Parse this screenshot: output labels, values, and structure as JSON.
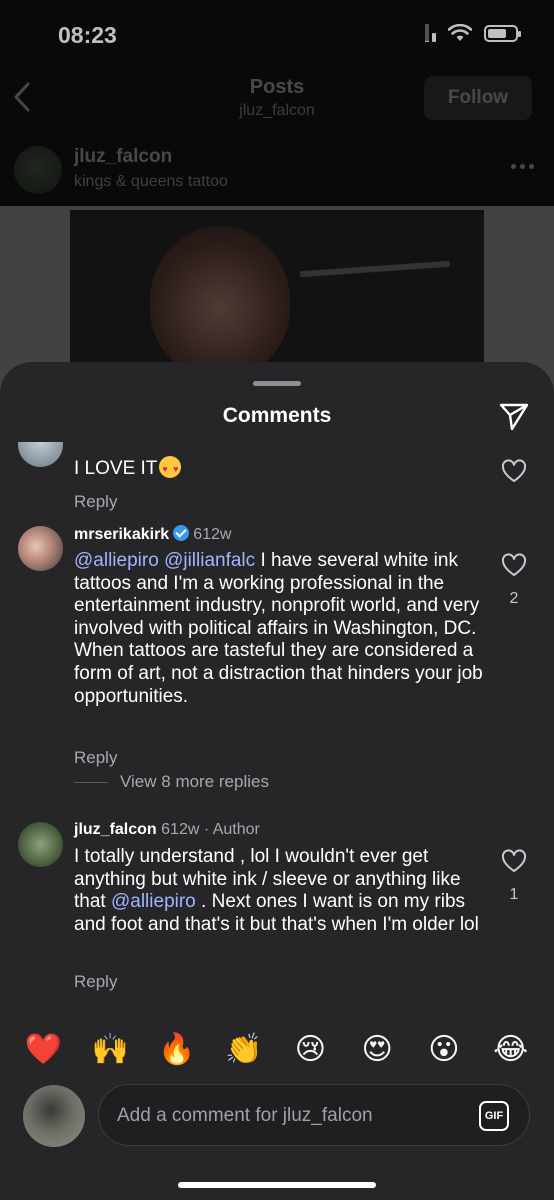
{
  "status_bar": {
    "time": "08:23"
  },
  "nav": {
    "title": "Posts",
    "subtitle": "jluz_falcon",
    "follow_label": "Follow"
  },
  "post": {
    "username": "jluz_falcon",
    "location": "kings & queens tattoo"
  },
  "sheet": {
    "title": "Comments"
  },
  "comments": [
    {
      "text": "I LOVE IT",
      "reply_label": "Reply"
    },
    {
      "username": "mrserikakirk",
      "verified": true,
      "time": "612w",
      "mentions": [
        "@alliepiro",
        "@jillianfalc"
      ],
      "text": " I have several white ink tattoos and I'm a working professional in the entertainment industry, nonprofit world, and very involved with political affairs in Washington, DC. When tattoos are tasteful they are considered a form of art, not a distraction that hinders your job opportunities.",
      "likes": "2",
      "reply_label": "Reply",
      "view_more": "View 8 more replies"
    },
    {
      "username": "jluz_falcon",
      "time": "612w",
      "author_tag": "· Author",
      "text_before": "I totally understand , lol I wouldn't ever get anything but white ink / sleeve or anything like that ",
      "mention": "@alliepiro",
      "text_after": " . Next ones I want is on my ribs and foot and that's it but that's when I'm older lol",
      "likes": "1",
      "reply_label": "Reply"
    }
  ],
  "emoji_bar": [
    "❤️",
    "🙌",
    "🔥",
    "👏",
    "😢",
    "😍",
    "😮",
    "😂"
  ],
  "composer": {
    "placeholder": "Add a comment for jluz_falcon",
    "gif_label": "GIF"
  },
  "colors": {
    "sheet_bg": "#262629",
    "mention": "#a3b4ff",
    "verified": "#3897f0",
    "muted": "#a8a8ad"
  }
}
